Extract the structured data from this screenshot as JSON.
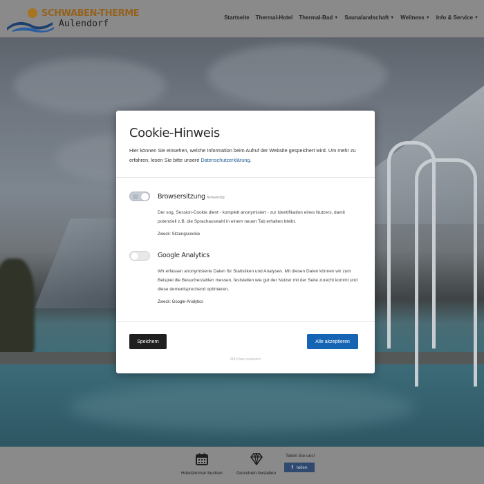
{
  "header": {
    "logo_line1": "SCHWABEN-THERME",
    "logo_line2": "Aulendorf",
    "nav": [
      {
        "label": "Startseite",
        "dropdown": false
      },
      {
        "label": "Thermal-Hotel",
        "dropdown": false
      },
      {
        "label": "Thermal-Bad",
        "dropdown": true
      },
      {
        "label": "Saunalandschaft",
        "dropdown": true
      },
      {
        "label": "Wellness",
        "dropdown": true
      },
      {
        "label": "Info & Service",
        "dropdown": true
      }
    ]
  },
  "modal": {
    "title": "Cookie-Hinweis",
    "intro_text": "Hier können Sie einsehen, welche Information beim Aufruf der Website gespeichert wird. Um mehr zu erfahren, lesen Sie bitte unsere ",
    "intro_link": "Datenschutzerklärung",
    "intro_end": ".",
    "cookies": [
      {
        "name": "Browsersitzung",
        "tag": "Notwendig",
        "enabled": true,
        "description": "Der sog. Session-Cookie dient - komplett anonymisiert - zur Identifikation eines Nutzers, damit potenziell z.B. die Sprachauswahl in einem neuen Tab erhalten bleibt.",
        "purpose": "Zweck: Sitzungscookie"
      },
      {
        "name": "Google Analytics",
        "tag": "",
        "enabled": false,
        "description": "Wir erfassen anonymisierte Daten für Statistiken und Analysen. Mit diesen Daten können wir zum Beispiel die Besucherzahlen messen, feststellen wie gut der Nutzer mit der Seite zurecht kommt und diese dementsprechend optimieren.",
        "purpose": "Zweck: Google-Analytics"
      }
    ],
    "save_label": "Speichern",
    "accept_label": "Alle akzeptieren",
    "made_with": "Mit Klaro realisiert"
  },
  "footer": {
    "hotel_label": "Hotelzimmer buchen",
    "voucher_label": "Gutschein bestellen",
    "share_title": "Teilen Sie uns!",
    "share_button": "teilen",
    "share_icon_text": "f"
  },
  "colors": {
    "header_bg": "#8a8a8a",
    "accept_button": "#1565b4",
    "save_button": "#1f1f1f",
    "link": "#1f5a96",
    "logo_orange": "#94621d",
    "share_button": "#2f4a6e"
  },
  "icons": [
    "calendar-icon",
    "diamond-icon",
    "facebook-icon",
    "caret-down-icon"
  ]
}
